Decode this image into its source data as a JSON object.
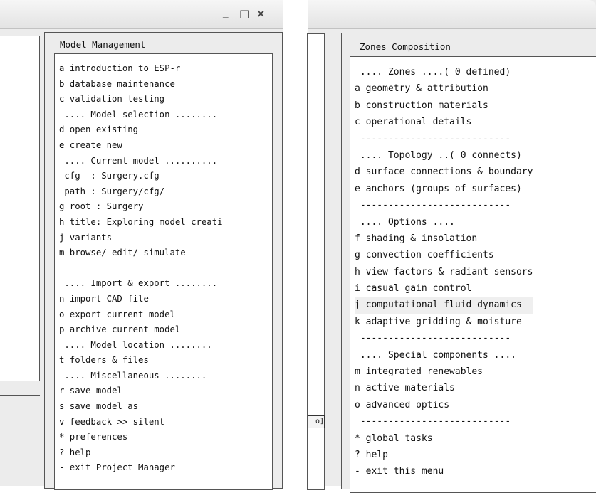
{
  "left_window": {
    "controls": {
      "minimize": "_",
      "maximize": "□",
      "close": "×"
    },
    "menu_title": "Model Management",
    "items": [
      "a introduction to ESP-r",
      "b database maintenance",
      "c validation testing",
      " .... Model selection ........",
      "d open existing",
      "e create new",
      " .... Current model ..........",
      " cfg  : Surgery.cfg",
      " path : Surgery/cfg/",
      "g root : Surgery",
      "h title: Exploring model creati",
      "j variants",
      "m browse/ edit/ simulate",
      "",
      " .... Import & export ........",
      "n import CAD file",
      "o export current model",
      "p archive current model",
      " .... Model location ........",
      "t folders & files",
      " .... Miscellaneous ........",
      "r save model",
      "s save model as",
      "v feedback >> silent",
      "* preferences",
      "? help",
      "- exit Project Manager"
    ]
  },
  "right_window": {
    "menu_title": "Zones Composition",
    "partial_button_label": "o]",
    "highlighted_index": 14,
    "items": [
      " .... Zones ....( 0 defined)",
      "a geometry & attribution",
      "b construction materials",
      "c operational details",
      " ---------------------------",
      " .... Topology ..( 0 connects)",
      "d surface connections & boundary",
      "e anchors (groups of surfaces)",
      " ---------------------------",
      " .... Options ....",
      "f shading & insolation",
      "g convection coefficients",
      "h view factors & radiant sensors",
      "i casual gain control",
      "j computational fluid dynamics",
      "k adaptive gridding & moisture",
      " ---------------------------",
      " .... Special components ....",
      "m integrated renewables",
      "n active materials",
      "o advanced optics",
      " ---------------------------",
      "* global tasks",
      "? help",
      "- exit this menu"
    ]
  }
}
